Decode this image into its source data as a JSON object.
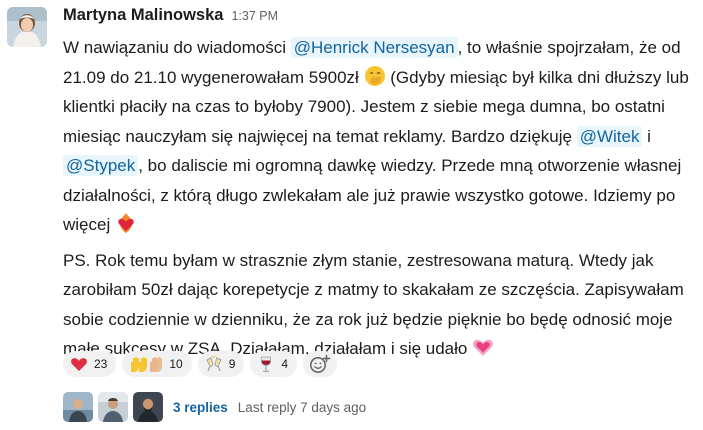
{
  "message": {
    "author": "Martyna Malinowska",
    "time": "1:37 PM",
    "p1": {
      "t1": "W nawiązaniu do wiadomości ",
      "mention1": "@Henrick Nersesyan",
      "t2": ", to właśnie spojrzałam, że od 21.09 do 21.10 wygenerowałam 5900zł ",
      "emoji1": "hand-over-mouth-emoji",
      "t3": " (Gdyby miesiąc był kilka dni dłuższy lub klientki płaciły na czas to byłoby 7900). Jestem z siebie mega dumna, bo ostatni miesiąc nauczyłam się najwięcej na temat reklamy. Bardzo dziękuję ",
      "mention2": "@Witek",
      "t4": " i ",
      "mention3": "@Stypek",
      "t5": ", bo daliscie mi ogromną dawkę wiedzy. Przede mną otworzenie własnej działalności, z którą długo zwlekałam ale już prawie wszystko gotowe. Idziemy po więcej ",
      "emoji2": "heart-on-fire-emoji"
    },
    "p2": {
      "t1": "PS. Rok temu byłam w strasznie złym stanie, zestresowana maturą. Wtedy jak zarobiłam 50zł dając korepetycje z matmy to skakałam ze szczęścia. Zapisywałam sobie codziennie w dzienniku, że za rok już będzie pięknie bo będę odnosić moje małe sukcesy w ZSA. Działałam, działałam i się udało ",
      "emoji1": "growing-heart-emoji"
    }
  },
  "reactions": [
    {
      "icon": "red-heart-icon",
      "count": "23"
    },
    {
      "icon": "raising-hands-icon",
      "count": "10"
    },
    {
      "icon": "clinking-glasses-icon",
      "count": "9"
    },
    {
      "icon": "wine-glass-icon",
      "count": "4"
    }
  ],
  "add_reaction_icon": "add-reaction-icon",
  "thread": {
    "replies": "3 replies",
    "last_reply": "Last reply 7 days ago"
  },
  "colors": {
    "link": "#1264a3",
    "mention_bg": "#e8f5fa",
    "text": "#1d1c1d",
    "muted": "#616061",
    "pill_bg": "#f1f1f1"
  }
}
